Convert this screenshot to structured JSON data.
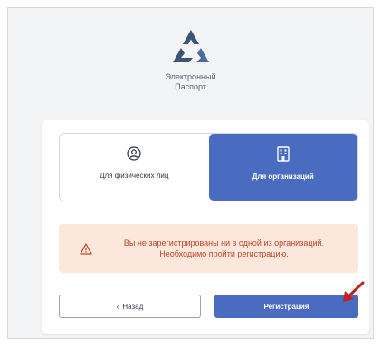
{
  "brand": {
    "line1": "Электронный",
    "line2": "Паспорт",
    "logo_icon": "triangle-logo-icon",
    "logo_color": "#3d5478"
  },
  "segments": [
    {
      "label": "Для физических лиц",
      "icon": "user-icon",
      "active": false
    },
    {
      "label": "Для организаций",
      "icon": "building-icon",
      "active": true
    }
  ],
  "alert": {
    "icon": "warning-icon",
    "text": "Вы не зарегистрированы ни в одной из организаций. Необходимо пройти регистрацию."
  },
  "buttons": {
    "back_label": "Назад",
    "back_icon": "chevron-left-icon",
    "register_label": "Регистрация"
  },
  "colors": {
    "accent": "#4a6cc0",
    "alert_bg": "#fbe7dc",
    "alert_text": "#c0452a",
    "arrow": "#c0211e"
  }
}
